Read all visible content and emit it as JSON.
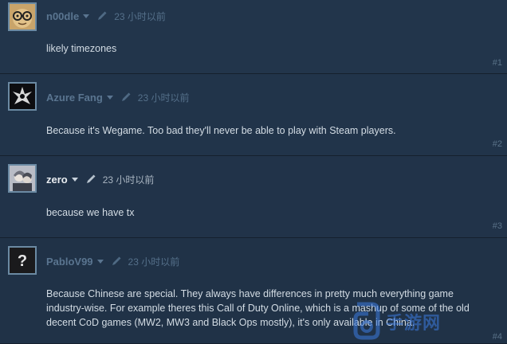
{
  "comments": [
    {
      "author": "n00dle",
      "online": false,
      "timestamp": "23 小时以前",
      "text": "likely timezones",
      "number": "#1",
      "avatar": "glasses-face-avatar"
    },
    {
      "author": "Azure Fang",
      "online": false,
      "timestamp": "23 小时以前",
      "text": "Because it's Wegame. Too bad they'll never be able to play with Steam players.",
      "number": "#2",
      "avatar": "dark-emblem-avatar"
    },
    {
      "author": "zero",
      "online": true,
      "timestamp": "23 小时以前",
      "text": "because we have tx",
      "number": "#3",
      "avatar": "anime-character-avatar"
    },
    {
      "author": "PabloV99",
      "online": false,
      "timestamp": "23 小时以前",
      "text": "Because Chinese are special. They always have differences in pretty much everything game industry-wise. For example theres this Call of Duty Online, which is a mashup of some of the old decent CoD games (MW2, MW3 and Black Ops mostly), it's only available in China.",
      "number": "#4",
      "avatar": "question-mark-avatar"
    }
  ],
  "colors": {
    "background": "#21344a",
    "author_offline": "#5a7590",
    "author_online": "#e8ecf0",
    "text": "#d3dce4",
    "watermark": "#3d7be0"
  },
  "watermark": {
    "text": "手游网",
    "icon": "logo-mark"
  }
}
